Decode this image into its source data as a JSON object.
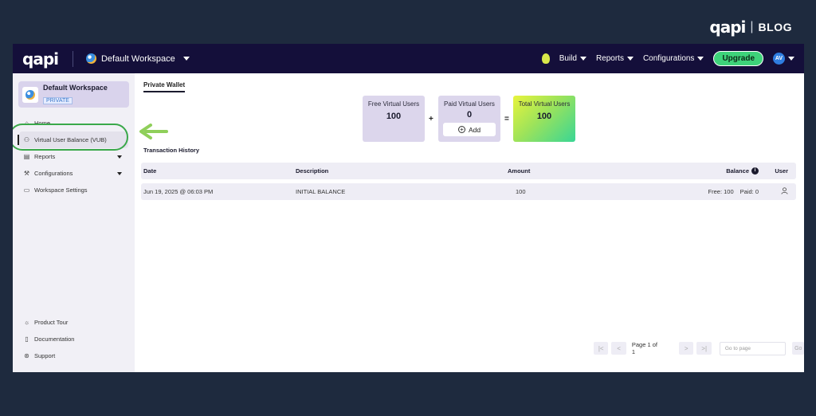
{
  "branding": {
    "logo_text": "qapi",
    "separator": "|",
    "blog_label": "BLOG"
  },
  "topnav": {
    "logo_text": "qapi",
    "workspace": "Default Workspace",
    "items": [
      {
        "label": "Build"
      },
      {
        "label": "Reports"
      },
      {
        "label": "Configurations"
      }
    ],
    "upgrade_label": "Upgrade",
    "avatar_initials": "AV"
  },
  "sidebar": {
    "workspace_title": "Default Workspace",
    "workspace_badge": "PRIVATE",
    "items": [
      {
        "label": "Home",
        "icon": "home-icon"
      },
      {
        "label": "Virtual User Balance (VUB)",
        "icon": "users-icon",
        "active": true
      },
      {
        "label": "Reports",
        "icon": "chart-icon"
      },
      {
        "label": "Configurations",
        "icon": "wrench-icon"
      },
      {
        "label": "Workspace Settings",
        "icon": "monitor-icon"
      }
    ],
    "bottom_items": [
      {
        "label": "Product Tour",
        "icon": "bulb-icon"
      },
      {
        "label": "Documentation",
        "icon": "document-icon"
      },
      {
        "label": "Support",
        "icon": "support-icon"
      }
    ]
  },
  "wallet": {
    "tab_label": "Private Wallet",
    "free": {
      "label": "Free Virtual Users",
      "value": "100"
    },
    "plus": "+",
    "paid": {
      "label": "Paid Virtual Users",
      "value": "0",
      "add_label": "Add"
    },
    "equals": "=",
    "total": {
      "label": "Total Virtual Users",
      "value": "100"
    }
  },
  "transactions": {
    "title": "Transaction History",
    "columns": [
      "Date",
      "Description",
      "Amount",
      "Balance",
      "User"
    ],
    "rows": [
      {
        "date": "Jun 19, 2025 @ 06:03 PM",
        "description": "INITIAL BALANCE",
        "amount": "100",
        "balance_free": "Free: 100",
        "balance_paid": "Paid: 0"
      }
    ]
  },
  "pagination": {
    "info": "Page 1 of 1",
    "goto_placeholder": "Go to page",
    "go_label": "Go"
  },
  "colors": {
    "background": "#1e2a3e",
    "topnav": "#140f3a",
    "accent_green": "#3ed37a",
    "highlight_ring": "#3aa84a"
  }
}
